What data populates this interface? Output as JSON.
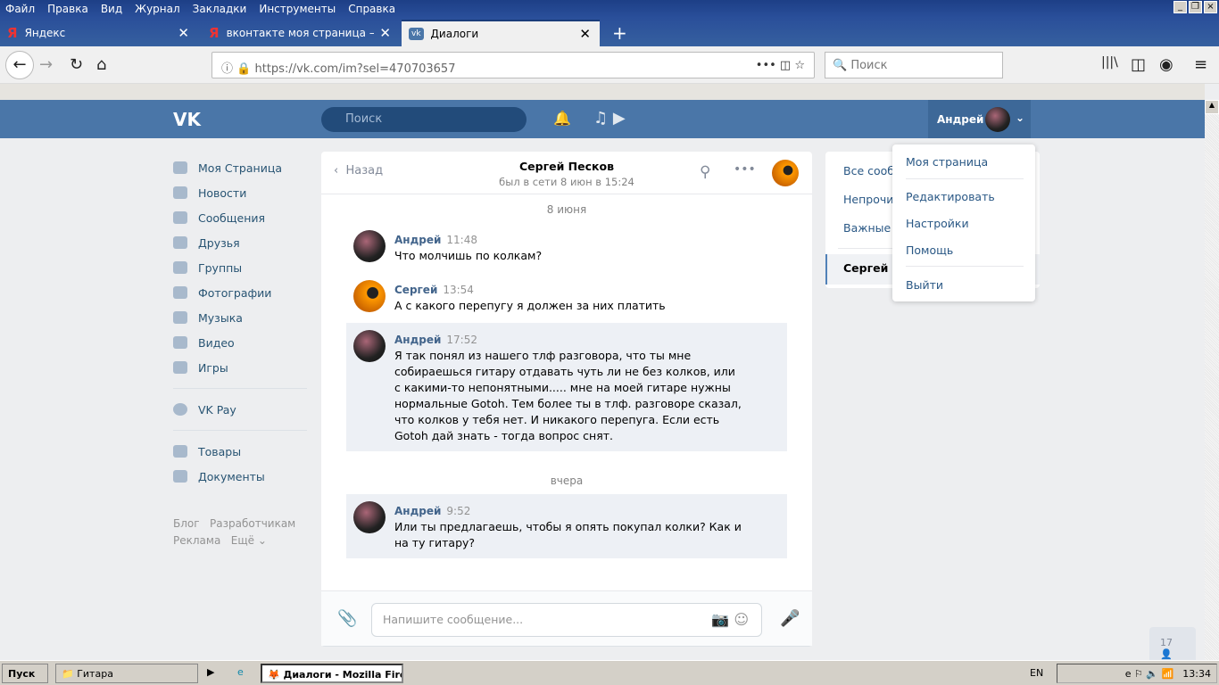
{
  "browser": {
    "menu": [
      "Файл",
      "Правка",
      "Вид",
      "Журнал",
      "Закладки",
      "Инструменты",
      "Справка"
    ],
    "tabs": [
      {
        "label": "Яндекс"
      },
      {
        "label": "вконтакте моя страница — Яндекс"
      },
      {
        "label": "Диалоги"
      }
    ],
    "url": "https://vk.com/im?sel=470703657",
    "search_placeholder": "Поиск"
  },
  "vk": {
    "search_placeholder": "Поиск",
    "user_name": "Андрей",
    "nav": [
      "Моя Страница",
      "Новости",
      "Сообщения",
      "Друзья",
      "Группы",
      "Фотографии",
      "Музыка",
      "Видео",
      "Игры",
      "VK Pay",
      "Товары",
      "Документы"
    ],
    "footer": [
      "Блог",
      "Разработчикам",
      "Реклама",
      "Ещё"
    ],
    "chat": {
      "back": "Назад",
      "title": "Сергей Песков",
      "status": "был в сети 8 июн в 15:24",
      "date1": "8 июня",
      "date2": "вчера",
      "messages": [
        {
          "name": "Андрей",
          "time": "11:48",
          "text": "Что молчишь по колкам?"
        },
        {
          "name": "Сергей",
          "time": "13:54",
          "text": "А с какого перепугу я должен за них платить"
        },
        {
          "name": "Андрей",
          "time": "17:52",
          "text": "Я так понял из нашего тлф разговора, что ты мне собираешься гитару отдавать чуть ли не без колков, или с какими-то непонятными..... мне на моей гитаре нужны нормальные Gotoh. Тем более ты в тлф. разговоре сказал, что колков у тебя нет. И никакого перепуга. Если есть Gotoh дай знать - тогда вопрос снят."
        },
        {
          "name": "Андрей",
          "time": "9:52",
          "text": "Или ты предлагаешь, чтобы я опять покупал колки? Как и на ту гитару?"
        }
      ],
      "input_placeholder": "Напишите сообщение..."
    },
    "right_panel": [
      "Все сообщения",
      "Непрочитанные",
      "Важные",
      "Сергей Песков"
    ],
    "dropdown": [
      "Моя страница",
      "Редактировать",
      "Настройки",
      "Помощь",
      "Выйти"
    ],
    "online_count": "17"
  },
  "taskbar": {
    "start": "Пуск",
    "items": [
      "Гитара",
      "Диалоги - Mozilla Fire..."
    ],
    "lang": "EN",
    "clock": "13:34"
  }
}
